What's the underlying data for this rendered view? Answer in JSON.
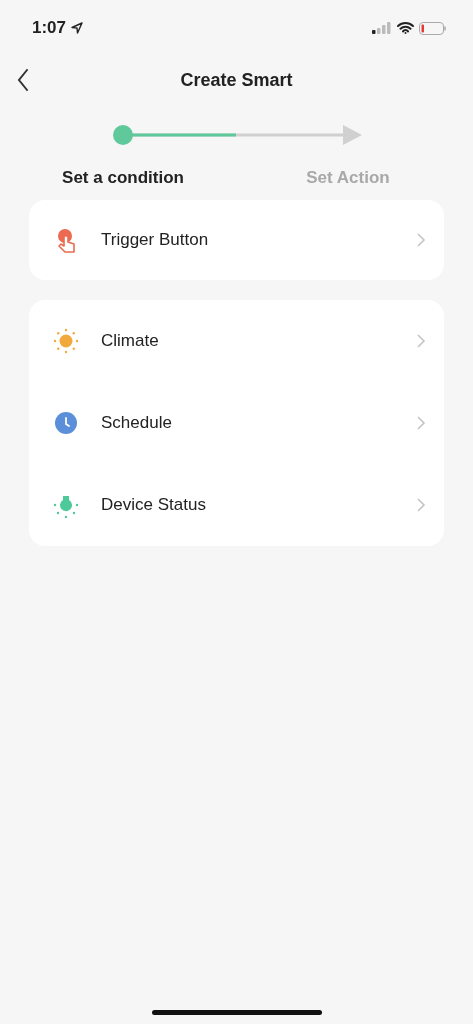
{
  "status_bar": {
    "time": "1:07"
  },
  "nav": {
    "title": "Create Smart"
  },
  "steps": [
    {
      "label": "Set a condition",
      "selected": true
    },
    {
      "label": "Set Action",
      "selected": false
    }
  ],
  "groups": [
    {
      "items": [
        {
          "kind": "trigger",
          "label": "Trigger Button"
        }
      ]
    },
    {
      "items": [
        {
          "kind": "climate",
          "label": "Climate"
        },
        {
          "kind": "schedule",
          "label": "Schedule"
        },
        {
          "kind": "device",
          "label": "Device Status"
        }
      ]
    }
  ]
}
